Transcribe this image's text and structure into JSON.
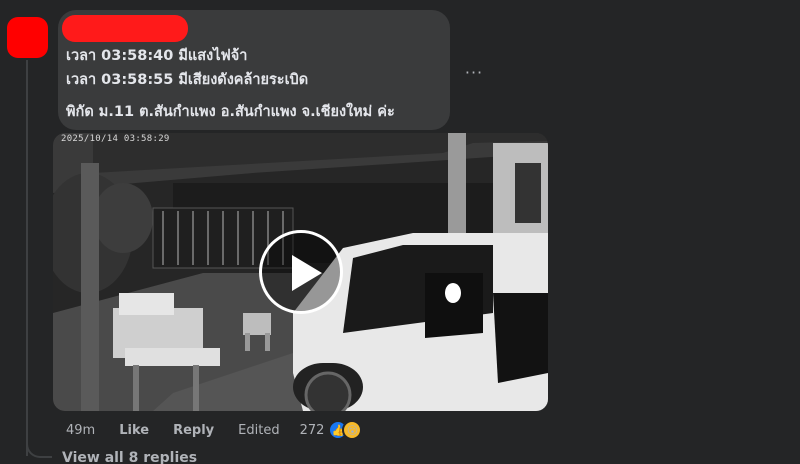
{
  "comment": {
    "lines": [
      "เวลา 03:58:40 มีแสงไฟจ้า",
      "เวลา 03:58:55 มีเสียงดังคล้ายระเบิด",
      "พิกัด ม.11 ต.สันกำแพง อ.สันกำแพง จ.เชียงใหม่ ค่ะ"
    ],
    "more_label": "···"
  },
  "video": {
    "timestamp": "2025/10/14  03:58:29"
  },
  "actions": {
    "time": "49m",
    "like": "Like",
    "reply": "Reply",
    "edited": "Edited",
    "reaction_count": "272"
  },
  "replies": {
    "label": "View all 8 replies"
  },
  "colors": {
    "background": "#242526",
    "bubble": "#3a3b3c",
    "redaction": "#ff0000",
    "like": "#1877f2"
  },
  "icons": [
    "like-reaction-icon",
    "wow-reaction-icon",
    "play-icon",
    "more-options-icon"
  ]
}
